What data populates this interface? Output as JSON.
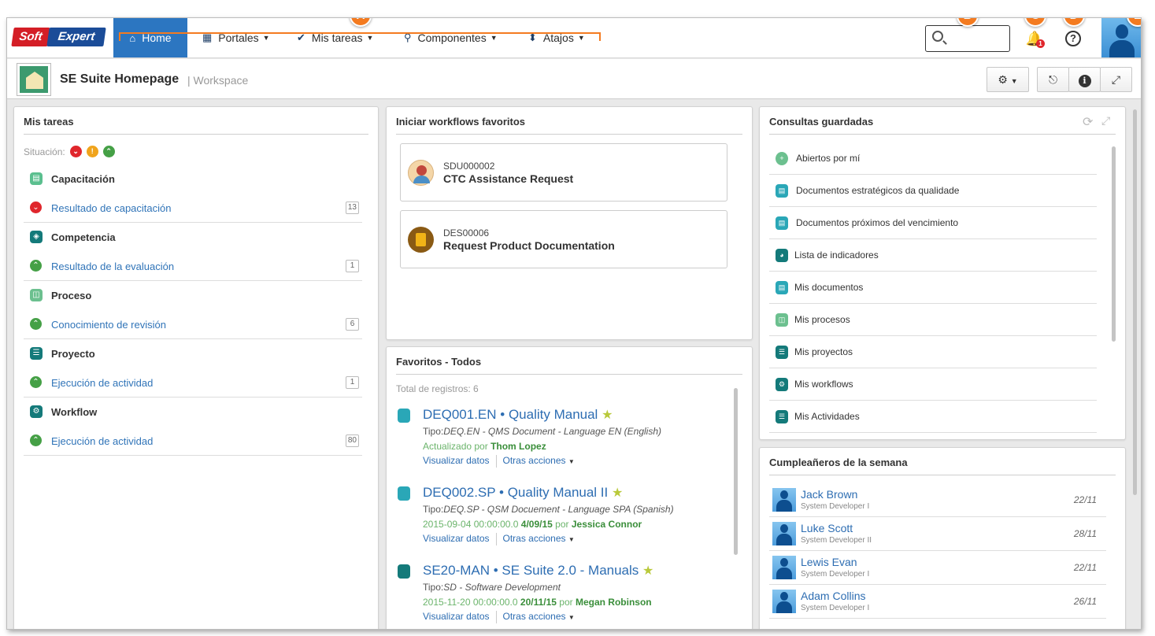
{
  "nav": {
    "home": "Home",
    "portales": "Portales",
    "mis_tareas": "Mis tareas",
    "componentes": "Componentes",
    "atajos": "Atajos"
  },
  "logo": {
    "part1": "Soft",
    "part2": "Expert"
  },
  "search": {
    "placeholder": ""
  },
  "notifications": {
    "count": "1"
  },
  "callouts": {
    "a": "A",
    "b": "B",
    "c": "C",
    "d": "D",
    "e": "E"
  },
  "page": {
    "title": "SE Suite Homepage",
    "subtitle": "| Workspace"
  },
  "mis_tareas": {
    "title": "Mis tareas",
    "situacion": "Situación:",
    "groups": [
      {
        "title": "Capacitación",
        "task": "Resultado de capacitación",
        "count": "13",
        "group_color": "#5bbf8f",
        "status_color": "#e0262c"
      },
      {
        "title": "Competencia",
        "task": "Resultado de la evaluación",
        "count": "1",
        "group_color": "#147a7a",
        "status_color": "#45a046"
      },
      {
        "title": "Proceso",
        "task": "Conocimiento de revisión",
        "count": "6",
        "group_color": "#6cc08f",
        "status_color": "#45a046"
      },
      {
        "title": "Proyecto",
        "task": "Ejecución de actividad",
        "count": "1",
        "group_color": "#147a7a",
        "status_color": "#45a046"
      },
      {
        "title": "Workflow",
        "task": "Ejecución de actividad",
        "count": "80",
        "group_color": "#147a7a",
        "status_color": "#45a046"
      }
    ]
  },
  "workflows": {
    "title": "Iniciar workflows favoritos",
    "items": [
      {
        "id": "SDU000002",
        "name": "CTC Assistance Request"
      },
      {
        "id": "DES00006",
        "name": "Request Product Documentation"
      }
    ]
  },
  "favoritos": {
    "title": "Favoritos - Todos",
    "total": "Total de registros: 6",
    "view_label": "Visualizar datos",
    "more_label": "Otras acciones",
    "items": [
      {
        "title": "DEQ001.EN • Quality Manual",
        "tipo_prefix": "Tipo:",
        "tipo": "DEQ.EN - QMS Document - Language EN (English)",
        "upd_prefix": "Actualizado por ",
        "upd_bold": "Thom Lopez",
        "upd_extra": "",
        "upd_by": ""
      },
      {
        "title": "DEQ002.SP • Quality Manual II",
        "tipo_prefix": "Tipo:",
        "tipo": "DEQ.SP - QSM Docuement - Language SPA (Spanish)",
        "upd_prefix": "2015-09-04 00:00:00.0 ",
        "upd_bold": "4/09/15",
        "upd_extra": " por ",
        "upd_by": "Jessica Connor"
      },
      {
        "title": "SE20-MAN • SE Suite 2.0 - Manuals",
        "tipo_prefix": "Tipo:",
        "tipo": "SD - Software Development",
        "upd_prefix": "2015-11-20 00:00:00.0 ",
        "upd_bold": "20/11/15",
        "upd_extra": " por ",
        "upd_by": "Megan Robinson"
      }
    ]
  },
  "consultas": {
    "title": "Consultas guardadas",
    "items": [
      "Abiertos por mí",
      "Documentos estratégicos da qualidade",
      "Documentos próximos del vencimiento",
      "Lista de indicadores",
      "Mis documentos",
      "Mis procesos",
      "Mis proyectos",
      "Mis workflows",
      "Mis Actividades"
    ]
  },
  "cumpleanos": {
    "title": "Cumpleañeros de la semana",
    "items": [
      {
        "name": "Jack Brown",
        "role": "System Developer I",
        "date": "22/11"
      },
      {
        "name": "Luke Scott",
        "role": "System Developer II",
        "date": "28/11"
      },
      {
        "name": "Lewis Evan",
        "role": "System Developer I",
        "date": "22/11"
      },
      {
        "name": "Adam Collins",
        "role": "System Developer I",
        "date": "26/11"
      }
    ]
  },
  "colors": {
    "accent": "#2c76c1",
    "callout": "#f47b20",
    "link": "#3074b8"
  }
}
